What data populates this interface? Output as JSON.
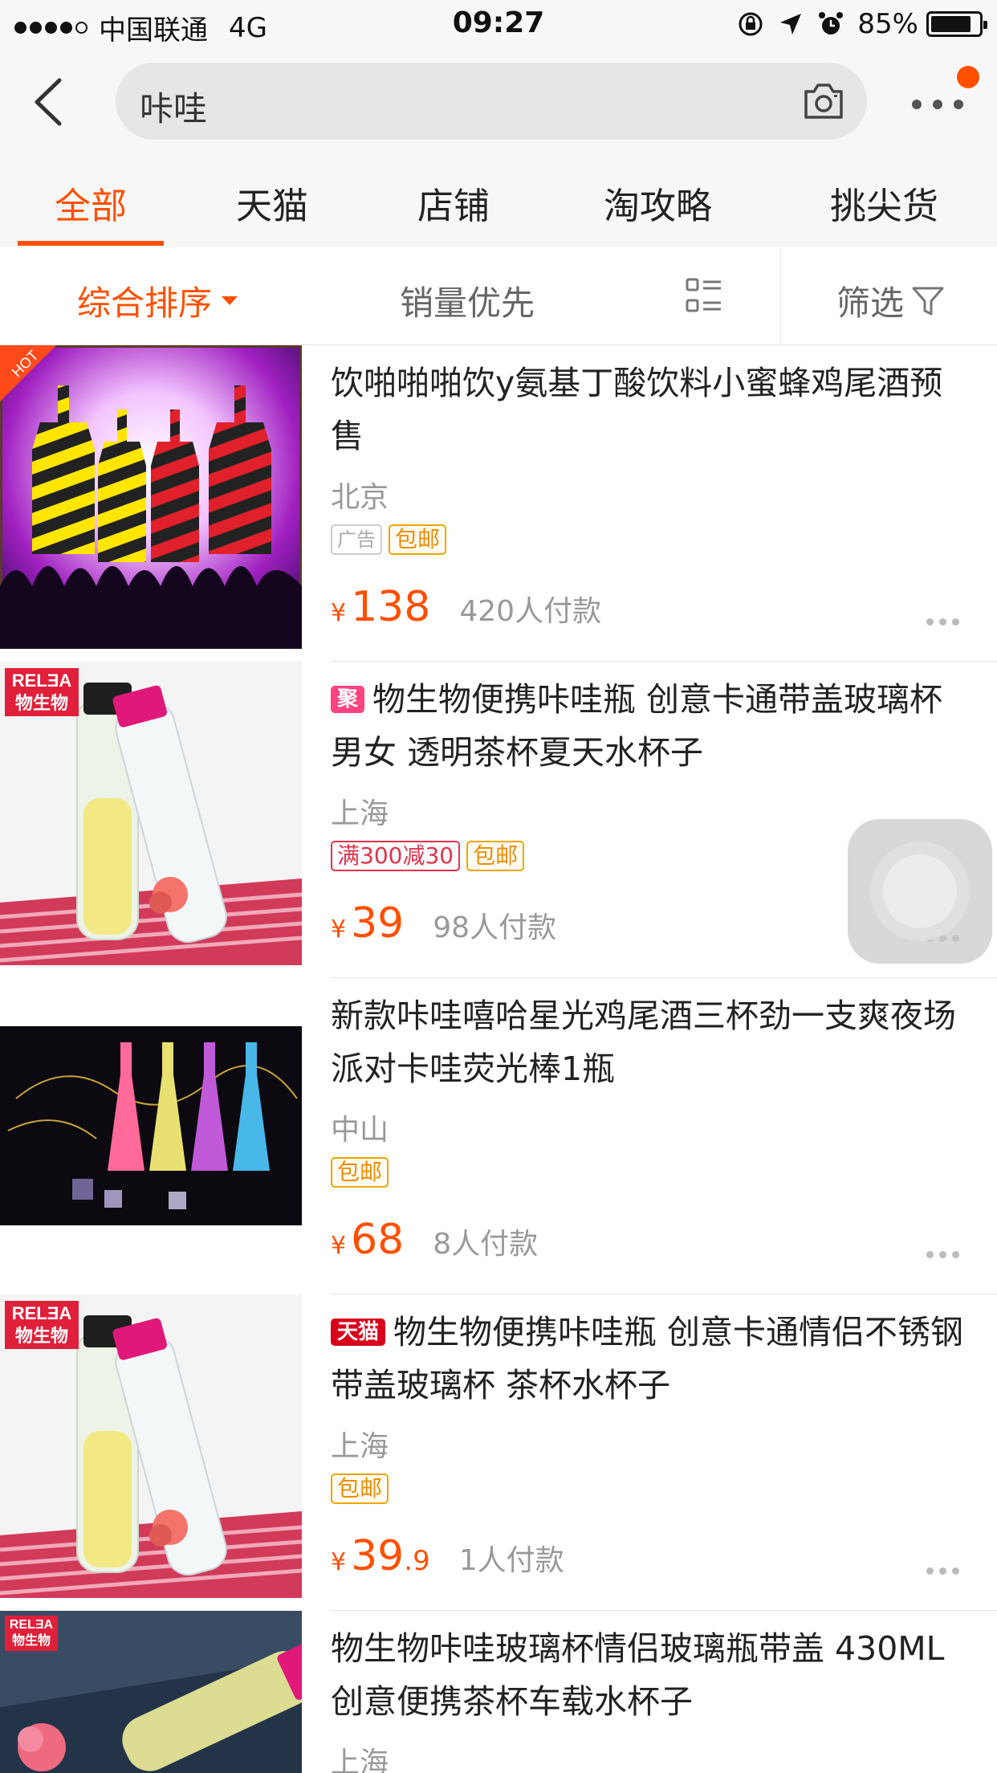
{
  "status_bar": {
    "carrier": "中国联通",
    "network": "4G",
    "time": "09:27",
    "battery": "85%",
    "battery_level": 0.85
  },
  "search": {
    "query": "咔哇"
  },
  "tabs": [
    {
      "label": "全部",
      "active": true
    },
    {
      "label": "天猫",
      "active": false
    },
    {
      "label": "店铺",
      "active": false
    },
    {
      "label": "淘攻略",
      "active": false
    },
    {
      "label": "挑尖货",
      "active": false
    }
  ],
  "sort": {
    "comprehensive": "综合排序",
    "sales_first": "销量优先",
    "filter": "筛选"
  },
  "products": [
    {
      "badge": "",
      "title": "饮啪啪啪饮y氨基丁酸饮料小蜜蜂鸡尾酒预售",
      "location": "北京",
      "tags": [
        "广告",
        "包邮"
      ],
      "currency": "¥",
      "price": "138",
      "price_decimal": "",
      "sales": "420人付款",
      "corner_label": "HOT",
      "image_label": ""
    },
    {
      "badge": "聚",
      "title": "物生物便携咔哇瓶 创意卡通带盖玻璃杯男女 透明茶杯夏天水杯子",
      "location": "上海",
      "tags": [
        "满300减30",
        "包邮"
      ],
      "currency": "¥",
      "price": "39",
      "price_decimal": "",
      "sales": "98人付款",
      "corner_label": "",
      "image_label": "RELƎA 物生物"
    },
    {
      "badge": "",
      "title": "新款咔哇嘻哈星光鸡尾酒三杯劲一支爽夜场派对卡哇荧光棒1瓶",
      "location": "中山",
      "tags": [
        "包邮"
      ],
      "currency": "¥",
      "price": "68",
      "price_decimal": "",
      "sales": "8人付款",
      "corner_label": "",
      "image_label": ""
    },
    {
      "badge": "天猫",
      "title": "物生物便携咔哇瓶 创意卡通情侣不锈钢带盖玻璃杯 茶杯水杯子",
      "location": "上海",
      "tags": [
        "包邮"
      ],
      "currency": "¥",
      "price": "39",
      "price_decimal": ".9",
      "sales": "1人付款",
      "corner_label": "",
      "image_label": "RELƎA 物生物"
    },
    {
      "badge": "",
      "title": "物生物咔哇玻璃杯情侣玻璃瓶带盖 430ML 创意便携茶杯车载水杯子",
      "location": "上海",
      "tags": [],
      "currency": "",
      "price": "",
      "price_decimal": "",
      "sales": "",
      "corner_label": "",
      "image_label": "RELƎA 物生物"
    }
  ],
  "colors": {
    "accent": "#ff5000",
    "bar_bg": "#f7f7f7",
    "tag_orange": "#f08c00",
    "tag_red": "#e0334c",
    "tmall_red": "#d8001b",
    "juhua_pink": "#ff4380"
  },
  "icons": {
    "back": "chevron-left-icon",
    "camera": "camera-icon",
    "more": "more-icon",
    "view": "list-view-icon",
    "filter": "funnel-icon"
  }
}
